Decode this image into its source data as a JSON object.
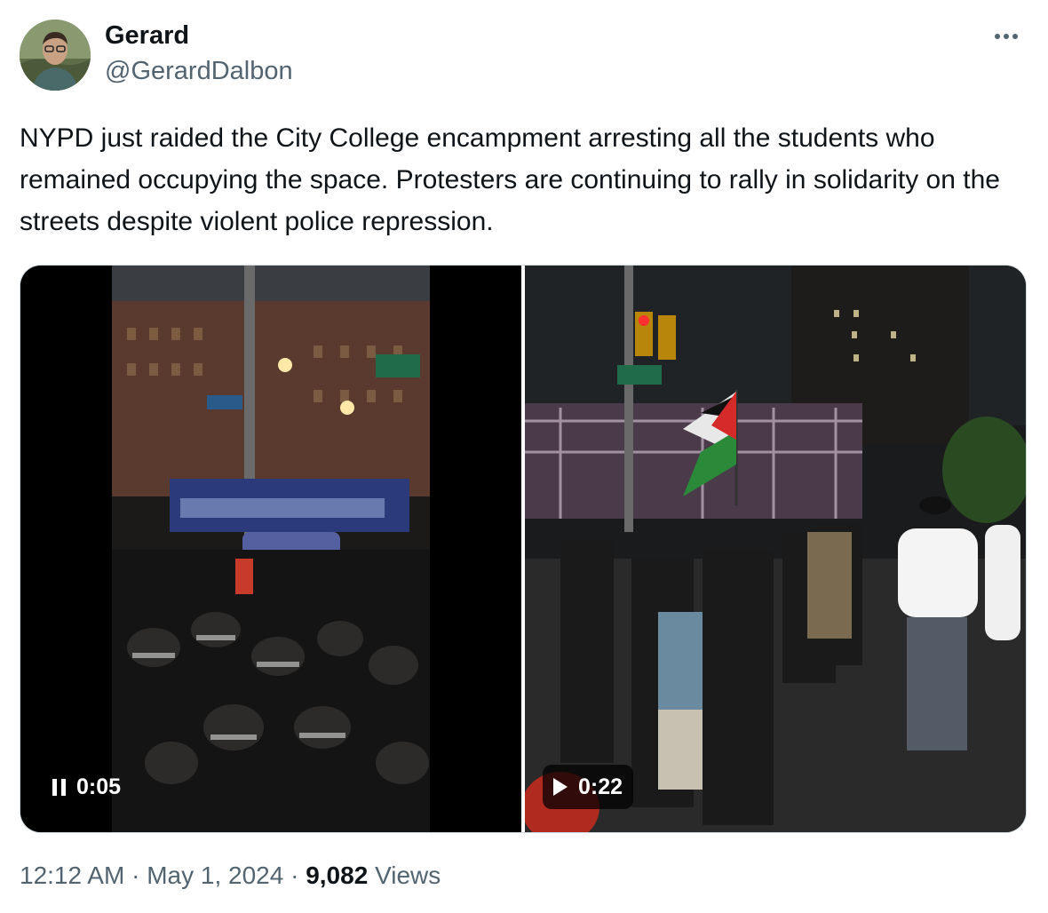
{
  "author": {
    "display_name": "Gerard",
    "handle": "@GerardDalbon"
  },
  "tweet": {
    "text": "NYPD just raided the City College encampment arresting all the students who remained occupying the space. Protesters are continuing to rally in solidarity on the streets despite violent police repression."
  },
  "media": {
    "left_video": {
      "state": "playing",
      "timestamp": "0:05"
    },
    "right_video": {
      "state": "paused",
      "timestamp": "0:22"
    }
  },
  "meta": {
    "time": "12:12 AM",
    "separator": "·",
    "date": "May 1, 2024",
    "views_count": "9,082",
    "views_label": "Views"
  },
  "icons": {
    "more": "more-icon",
    "pause": "pause-icon",
    "play": "play-icon"
  }
}
